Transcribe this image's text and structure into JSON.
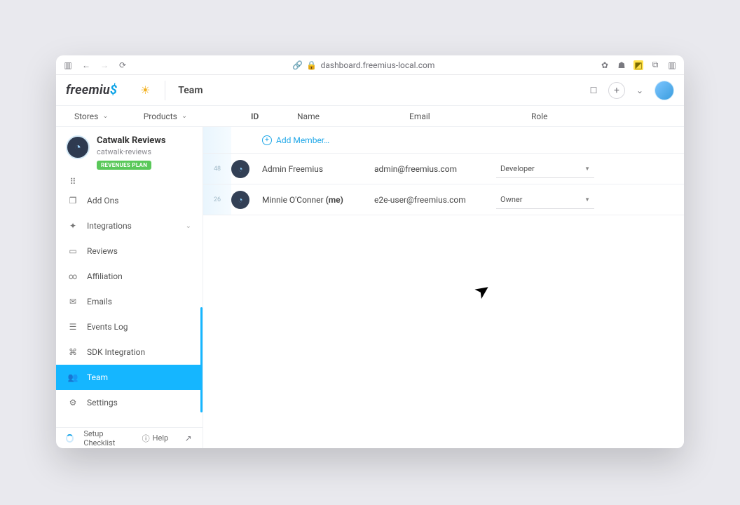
{
  "browser": {
    "url": "dashboard.freemius-local.com"
  },
  "app": {
    "logo_text": "freemiu",
    "logo_dollar": "$",
    "page_title": "Team"
  },
  "nav_tabs": {
    "stores": "Stores",
    "products": "Products"
  },
  "product": {
    "name": "Catwalk Reviews",
    "slug": "catwalk-reviews",
    "plan_badge": "REVENUES PLAN"
  },
  "sidebar": {
    "items": [
      {
        "label": ""
      },
      {
        "label": "Add Ons"
      },
      {
        "label": "Integrations"
      },
      {
        "label": "Reviews"
      },
      {
        "label": "Affiliation"
      },
      {
        "label": "Emails"
      },
      {
        "label": "Events Log"
      },
      {
        "label": "SDK Integration"
      },
      {
        "label": "Team"
      },
      {
        "label": "Settings"
      }
    ]
  },
  "footer": {
    "setup": "Setup Checklist",
    "help": "Help"
  },
  "table": {
    "headers": {
      "id": "ID",
      "name": "Name",
      "email": "Email",
      "role": "Role"
    },
    "add_member": "Add Member…",
    "rows": [
      {
        "id": "48",
        "name": "Admin Freemius",
        "me": "",
        "email": "admin@freemius.com",
        "role": "Developer"
      },
      {
        "id": "26",
        "name": "Minnie O'Conner",
        "me": "(me)",
        "email": "e2e-user@freemius.com",
        "role": "Owner"
      }
    ]
  }
}
